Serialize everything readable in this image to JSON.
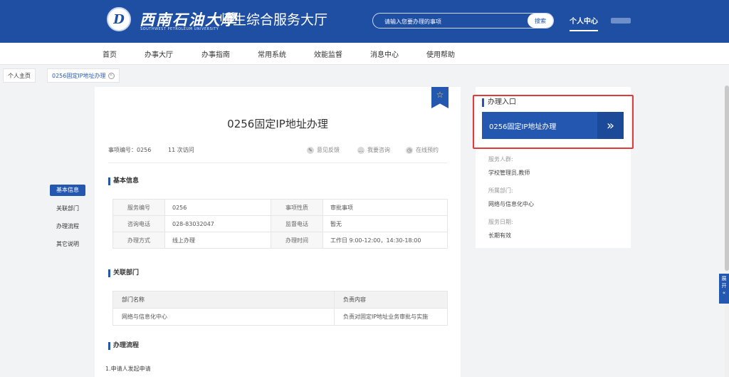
{
  "header": {
    "logo_text_cn": "西南石油大學",
    "logo_text_en": "SOUTHWEST PETROLEUM UNIVERSITY",
    "title": "师生综合服务大厅",
    "search_placeholder": "请输入您要办理的事项",
    "search_button": "搜索",
    "user_center": "个人中心"
  },
  "nav": {
    "items": [
      "首页",
      "办事大厅",
      "办事指南",
      "常用系统",
      "效能监督",
      "消息中心",
      "使用帮助"
    ]
  },
  "tabs": {
    "home": "个人主页",
    "current": "0256固定IP地址办理"
  },
  "side_nav": {
    "items": [
      "基本信息",
      "关联部门",
      "办理流程",
      "其它说明"
    ]
  },
  "main": {
    "title": "0256固定IP地址办理",
    "item_code": "事项编号：0256",
    "visits": "11 次访问",
    "actions": [
      "意见反馈",
      "我要咨询",
      "在线预约"
    ],
    "section_basic": "基本信息",
    "section_dept": "关联部门",
    "section_flow": "办理流程",
    "basic_info": [
      [
        "服务编号",
        "0256",
        "事项性质",
        "审批事项"
      ],
      [
        "咨询电话",
        "028-83032047",
        "监督电话",
        "暂无"
      ],
      [
        "办理方式",
        "线上办理",
        "办理时间",
        "工作日 9:00-12:00，14:30-18:00"
      ]
    ],
    "dept_header": [
      "部门名称",
      "负责内容"
    ],
    "dept_rows": [
      [
        "网络与信息化中心",
        "负责对固定IP地址业务审批与实施"
      ]
    ],
    "flow_steps": [
      "1.申请人发起申请"
    ]
  },
  "right": {
    "entry_title": "办理入口",
    "entry_button": "0256固定IP地址办理",
    "service_group_label": "服务人群:",
    "service_group_value": "学校管理员,教师",
    "dept_label": "所属部门:",
    "dept_value": "网络与信息化中心",
    "date_label": "服务日期:",
    "date_value": "长期有效"
  },
  "expand": {
    "label_1": "展",
    "label_2": "开",
    "label_3": "«"
  },
  "colors": {
    "brand": "#1f4fa3",
    "accent": "#2457b0",
    "highlight": "#e03a3a"
  }
}
